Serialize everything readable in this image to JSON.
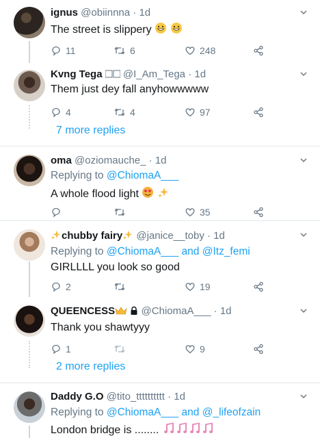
{
  "tweets": [
    {
      "name": "ignus",
      "handle": "@obiinnna",
      "time": "1d",
      "text": "The street is slippery",
      "text_emoji": [
        "grinning-face",
        "grinning-face"
      ],
      "replies": "11",
      "retweets": "6",
      "likes": "248"
    },
    {
      "name": "Kvng Tega",
      "handle": "@I_Am_Tega",
      "time": "1d",
      "text": "Them just dey fall anyhowwwww",
      "replies": "4",
      "retweets": "4",
      "likes": "97"
    },
    {
      "name": "oma",
      "handle": "@oziomauche_",
      "time": "1d",
      "replying_label": "Replying to",
      "mention1": "@ChiomaA___",
      "text": "A whole flood light",
      "text_emoji": [
        "heart-eyes",
        "sparkles"
      ],
      "replies": "",
      "retweets": "",
      "likes": "35"
    },
    {
      "name": "chubby fairy",
      "handle": "@janice__toby",
      "time": "1d",
      "replying_label": "Replying to",
      "mention1": "@ChiomaA___",
      "and_label": "and",
      "mention2": "@Itz_femi",
      "text": "GIRLLLL you look so good",
      "replies": "2",
      "retweets": "",
      "likes": "19"
    },
    {
      "name": "QUEENCESS",
      "handle": "@ChiomaA___",
      "time": "1d",
      "text": "Thank you shawtyyy",
      "replies": "1",
      "retweets": "",
      "likes": "9"
    },
    {
      "name": "Daddy G.O",
      "handle": "@tito_tttttttttt",
      "time": "1d",
      "replying_label": "Replying to",
      "mention1": "@ChiomaA___",
      "and_label": "and",
      "mention2": "@_lifeofzain",
      "text": "London bridge is ........",
      "text_emoji": [
        "musical-notes",
        "musical-notes",
        "musical-notes",
        "musical-notes"
      ]
    }
  ],
  "threads": {
    "first_more": "7 more replies",
    "second_more": "2 more replies"
  },
  "separator": "·",
  "colors": {
    "link": "#1da1f2",
    "muted": "#657786",
    "divider": "#e1e8ed"
  }
}
